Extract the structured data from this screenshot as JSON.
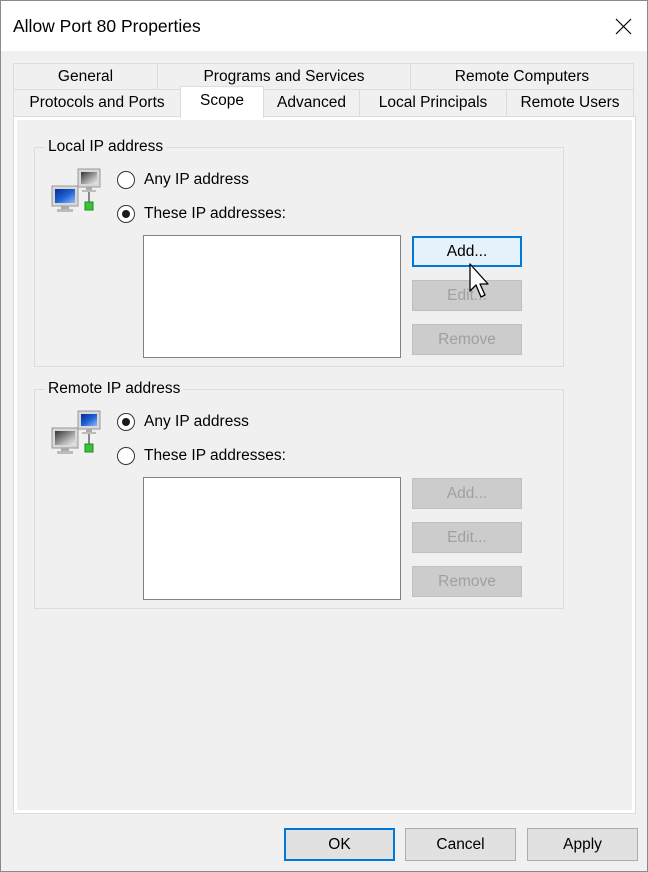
{
  "window": {
    "title": "Allow Port 80 Properties",
    "close_icon": "close-icon"
  },
  "tabs": {
    "row1": [
      {
        "label": "General"
      },
      {
        "label": "Programs and Services"
      },
      {
        "label": "Remote Computers"
      }
    ],
    "row2": [
      {
        "label": "Protocols and Ports"
      },
      {
        "label": "Scope",
        "active": true
      },
      {
        "label": "Advanced"
      },
      {
        "label": "Local Principals"
      },
      {
        "label": "Remote Users"
      }
    ]
  },
  "local_ip": {
    "group_label": "Local IP address",
    "icon": "network-computers-icon",
    "options": [
      {
        "label": "Any IP address",
        "checked": false
      },
      {
        "label": "These IP addresses:",
        "checked": true
      }
    ],
    "addresses": [],
    "buttons": {
      "add": {
        "label": "Add...",
        "enabled": true,
        "focused": true
      },
      "edit": {
        "label": "Edit...",
        "enabled": false
      },
      "remove": {
        "label": "Remove",
        "enabled": false
      }
    }
  },
  "remote_ip": {
    "group_label": "Remote IP address",
    "icon": "network-computers-icon",
    "options": [
      {
        "label": "Any IP address",
        "checked": true
      },
      {
        "label": "These IP addresses:",
        "checked": false
      }
    ],
    "addresses": [],
    "buttons": {
      "add": {
        "label": "Add...",
        "enabled": false
      },
      "edit": {
        "label": "Edit...",
        "enabled": false
      },
      "remove": {
        "label": "Remove",
        "enabled": false
      }
    }
  },
  "footer": {
    "ok": "OK",
    "cancel": "Cancel",
    "apply": "Apply"
  },
  "colors": {
    "accent": "#0078d7",
    "background": "#f0f0f0"
  }
}
